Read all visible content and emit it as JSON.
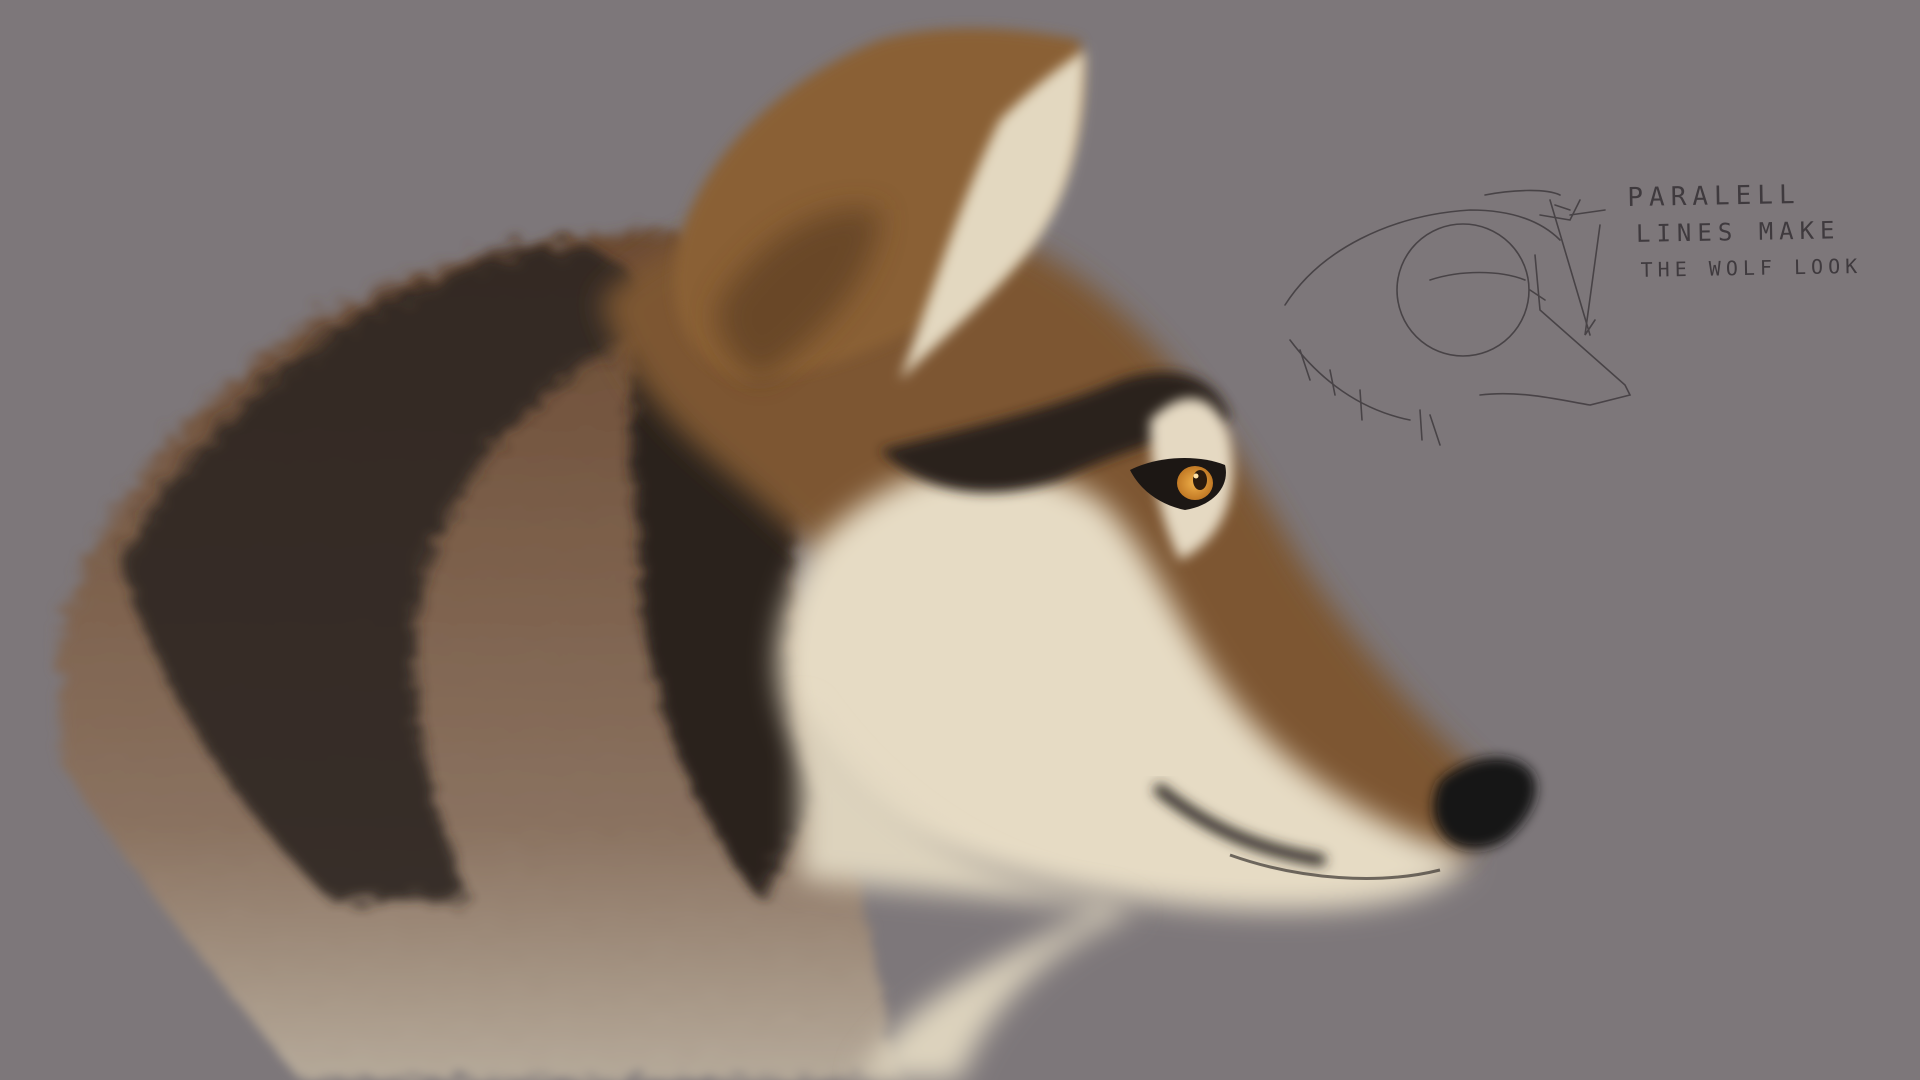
{
  "annotation": {
    "line1": "PARALELL",
    "line2": "LINES MAKE",
    "line3": "THE WOLF LOOK"
  },
  "colors": {
    "background": "#7d777a",
    "fur_brown": "#7a5430",
    "fur_dark": "#2b2520",
    "fur_cream": "#e8ddc6",
    "eye": "#d58d2b",
    "nose": "#1a1619",
    "sketch_line": "#3f3a3e"
  },
  "icons": {
    "painting": "wolf-head-profile-painting",
    "sketch": "wolf-head-construction-sketch"
  }
}
